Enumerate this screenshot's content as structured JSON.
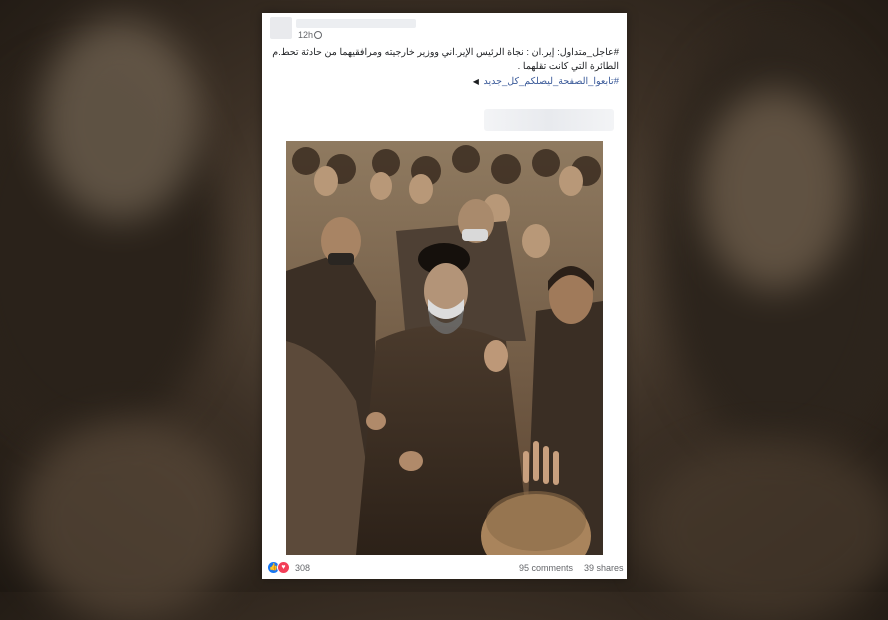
{
  "post": {
    "timestamp": "12h",
    "body": "#عاجل_متداول: إير.ان : نجاة الرئيس الإير.اني ووزير خارجيته ومرافقيهما من حادثة تحط.م الطائرة التي كانت تقلهما .",
    "link_text": "#تابعوا_الصفحة_ليصلكم_كل_جديد",
    "reactions_count": "308",
    "comments_label": "95 comments",
    "shares_label": "39 shares"
  },
  "icons": {
    "globe": "globe-icon",
    "like": "like-reaction-icon",
    "love": "love-reaction-icon",
    "pointer": "pointing-hand-icon"
  },
  "colors": {
    "link": "#385898",
    "like": "#1877f2",
    "love": "#f33e58"
  }
}
